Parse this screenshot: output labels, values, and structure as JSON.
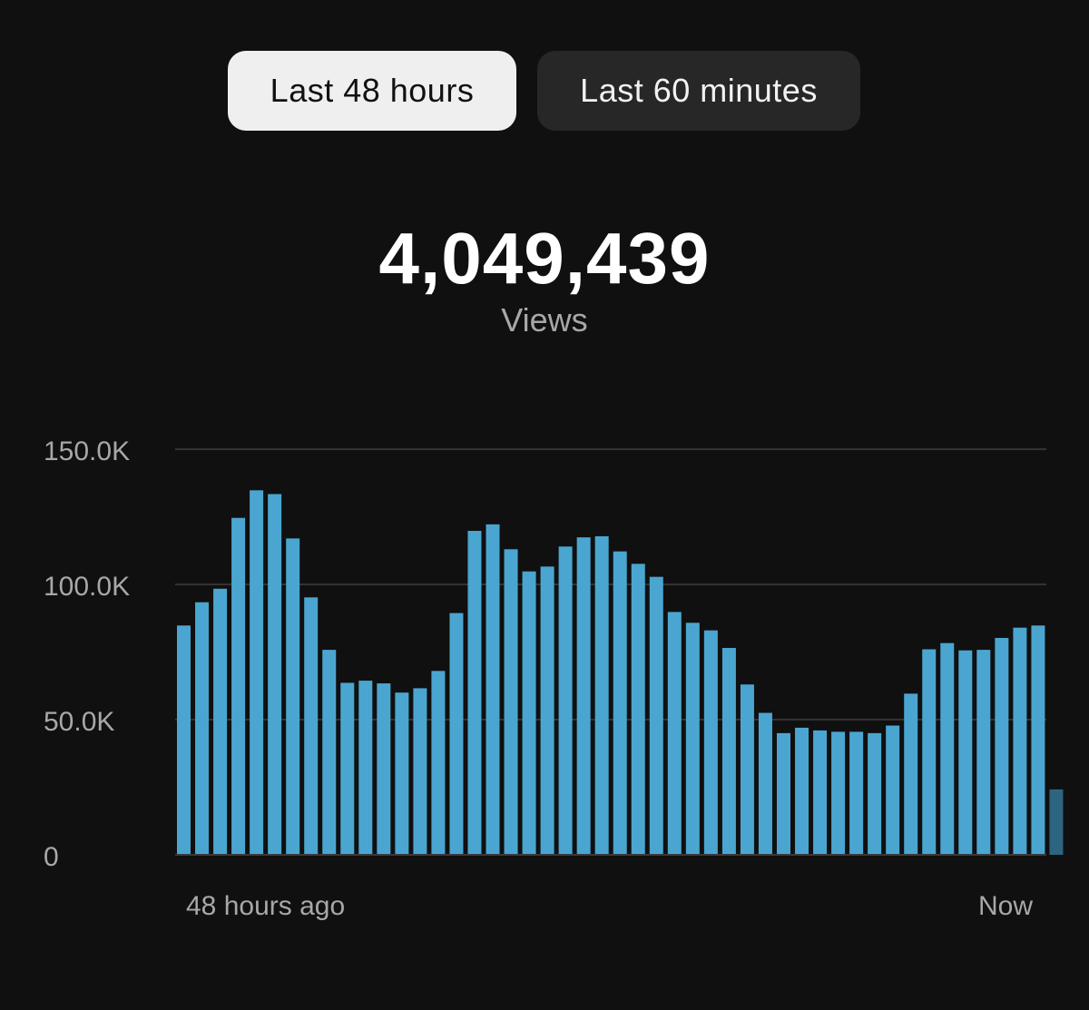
{
  "tabs": [
    {
      "label": "Last 48 hours",
      "active": true
    },
    {
      "label": "Last 60 minutes",
      "active": false
    }
  ],
  "summary": {
    "value": "4,049,439",
    "label": "Views"
  },
  "colors": {
    "background": "#101010",
    "bar": "#4aa6d0",
    "bar_current": "#2d6580",
    "grid": "#333333",
    "tick_text": "#a8a8a8"
  },
  "chart_data": {
    "type": "bar",
    "title": "",
    "xlabel": "",
    "ylabel": "",
    "ylim": [
      0,
      150000
    ],
    "y_ticks": [
      {
        "value": 0,
        "label": "0"
      },
      {
        "value": 50000,
        "label": "50.0K"
      },
      {
        "value": 100000,
        "label": "100.0K"
      },
      {
        "value": 150000,
        "label": "150.0K"
      }
    ],
    "x_labels": {
      "start": "48 hours ago",
      "end": "Now"
    },
    "grid": true,
    "values": [
      84800,
      93400,
      98400,
      124600,
      134800,
      133400,
      117000,
      95200,
      75800,
      63600,
      64400,
      63400,
      60000,
      61600,
      68000,
      89400,
      119800,
      122200,
      113000,
      104800,
      106600,
      114000,
      117400,
      117800,
      112200,
      107600,
      102800,
      89800,
      85800,
      83000,
      76500,
      63000,
      52500,
      45000,
      47000,
      46000,
      45500,
      45500,
      45000,
      47800,
      59600,
      76000,
      78300,
      75600,
      75800,
      80200,
      84000,
      84800,
      24200
    ],
    "current_index": 48
  }
}
